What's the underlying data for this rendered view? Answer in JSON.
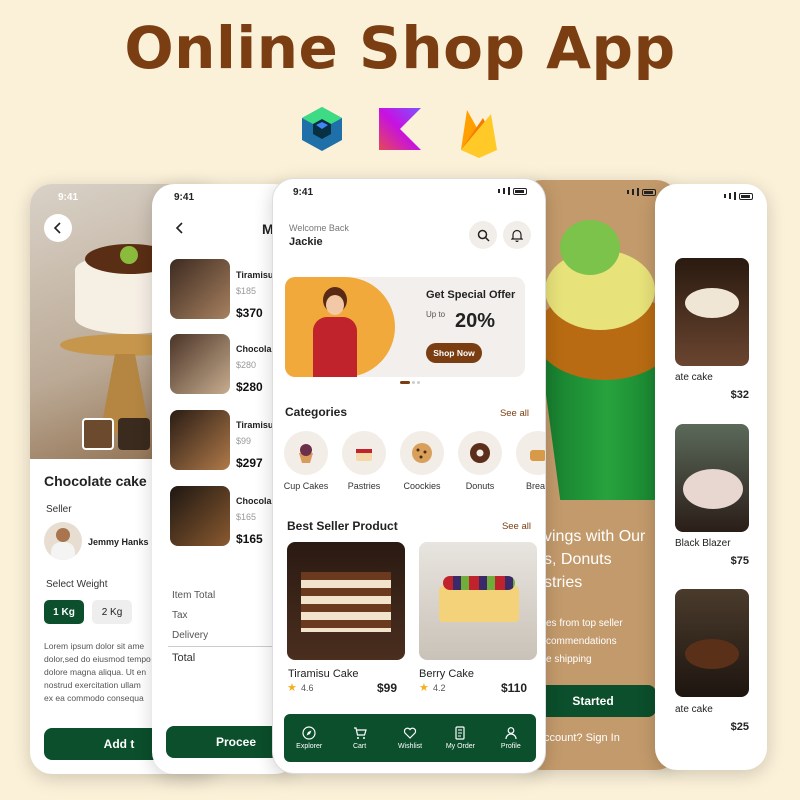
{
  "page_title": "Online Shop App",
  "logos": [
    "jetpack-compose-icon",
    "kotlin-icon",
    "firebase-icon"
  ],
  "status_time": "9:41",
  "detail": {
    "name": "Chocolate cake",
    "seller_label": "Seller",
    "seller_name": "Jemmy Hanks",
    "weight_label": "Select Weight",
    "weights": [
      "1 Kg",
      "2 Kg"
    ],
    "description": [
      "Lorem ipsum dolor sit ame",
      "dolor,sed do eiusmod tempo",
      "dolore magna aliqua. Ut en",
      "nostrud exercitation ullam",
      "ex ea commodo consequa"
    ],
    "add_button": "Add t"
  },
  "cart": {
    "header": "M",
    "items": [
      {
        "name": "Tiramisu",
        "sub": "$185",
        "price": "$370"
      },
      {
        "name": "Chocola",
        "sub": "$280",
        "price": "$280"
      },
      {
        "name": "Tiramisu",
        "sub": "$99",
        "price": "$297"
      },
      {
        "name": "Chocola",
        "sub": "$165",
        "price": "$165"
      }
    ],
    "summary": [
      "Item Total",
      "Tax",
      "Delivery"
    ],
    "total_label": "Total",
    "proceed_button": "Procee"
  },
  "home": {
    "welcome": "Welcome Back",
    "user": "Jackie",
    "banner_title": "Get Special Offer",
    "banner_upto": "Up to",
    "banner_percent": "20%",
    "banner_button": "Shop Now",
    "categories_title": "Categories",
    "see_all": "See all",
    "categories": [
      "Cup Cakes",
      "Pastries",
      "Coockies",
      "Donuts",
      "Bread"
    ],
    "best_title": "Best Seller Product",
    "products": [
      {
        "name": "Tiramisu Cake",
        "rating": "4.6",
        "price": "$99"
      },
      {
        "name": "Berry Cake",
        "rating": "4.2",
        "price": "$110"
      }
    ],
    "nav": [
      "Explorer",
      "Cart",
      "Wishlist",
      "My Order",
      "Profile"
    ]
  },
  "intro": {
    "headline": [
      "vings with Our",
      "s, Donuts",
      "stries"
    ],
    "sub": [
      "es from top seller",
      "commendations",
      "e shipping"
    ],
    "start_button": "Started",
    "signin": "ccount? Sign In"
  },
  "list": {
    "items": [
      {
        "name": "ate cake",
        "price": "$32"
      },
      {
        "name": "Black Blazer",
        "price": "$75"
      },
      {
        "name": "ate cake",
        "price": "$25"
      }
    ]
  }
}
